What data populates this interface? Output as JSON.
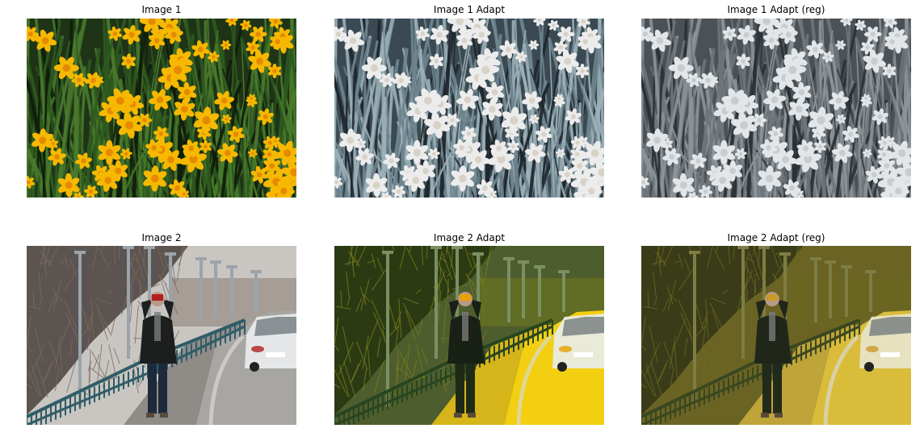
{
  "figure": {
    "panels": [
      {
        "title": "Image 1",
        "scene": "flowers",
        "style": "original"
      },
      {
        "title": "Image 1 Adapt",
        "scene": "flowers",
        "style": "adapt"
      },
      {
        "title": "Image 1 Adapt (reg)",
        "scene": "flowers",
        "style": "reg"
      },
      {
        "title": "Image 2",
        "scene": "street",
        "style": "original"
      },
      {
        "title": "Image 2 Adapt",
        "scene": "street",
        "style": "adapt"
      },
      {
        "title": "Image 2 Adapt (reg)",
        "scene": "street",
        "style": "reg"
      }
    ],
    "palettes": {
      "flowers": {
        "original": {
          "bg": "#1f3417",
          "leafA": "#2d5a1f",
          "leafB": "#4a7a2c",
          "dark": "#0f1d0a",
          "petal": "#f6b800",
          "center": "#e58a00"
        },
        "adapt": {
          "bg": "#3b4a52",
          "leafA": "#6f858f",
          "leafB": "#9cb0b8",
          "dark": "#1e262b",
          "petal": "#ececec",
          "center": "#d8d2c6"
        },
        "reg": {
          "bg": "#4b5257",
          "leafA": "#6e767b",
          "leafB": "#8d959a",
          "dark": "#2a3033",
          "petal": "#e3e6e8",
          "center": "#c9ccce"
        }
      },
      "street": {
        "original": {
          "sky": "#c9c6c2",
          "trees": "#5b5450",
          "treesB": "#7a6a62",
          "road": "#a8a6a3",
          "walk": "#8f8c88",
          "fence": "#2f5c68",
          "pole": "#9aa4aa",
          "coat": "#1c1f1e",
          "jeans": "#1d2a3c",
          "car": "#e4e6e8",
          "accent": "#b02020"
        },
        "adapt": {
          "sky": "#4d5d2e",
          "trees": "#2c3a14",
          "treesB": "#7a7e18",
          "road": "#f2cf10",
          "walk": "#d6b51a",
          "fence": "#27451f",
          "pole": "#7c8f63",
          "coat": "#192016",
          "jeans": "#1f2a16",
          "car": "#e9ead8",
          "accent": "#e8a000"
        },
        "reg": {
          "sky": "#6a6324",
          "trees": "#3a3b18",
          "treesB": "#6a6a22",
          "road": "#d9bc3a",
          "walk": "#bfa43a",
          "fence": "#3a4720",
          "pole": "#7d7d44",
          "coat": "#20261a",
          "jeans": "#222a1c",
          "car": "#e6e2c0",
          "accent": "#c99a2a"
        }
      }
    }
  }
}
